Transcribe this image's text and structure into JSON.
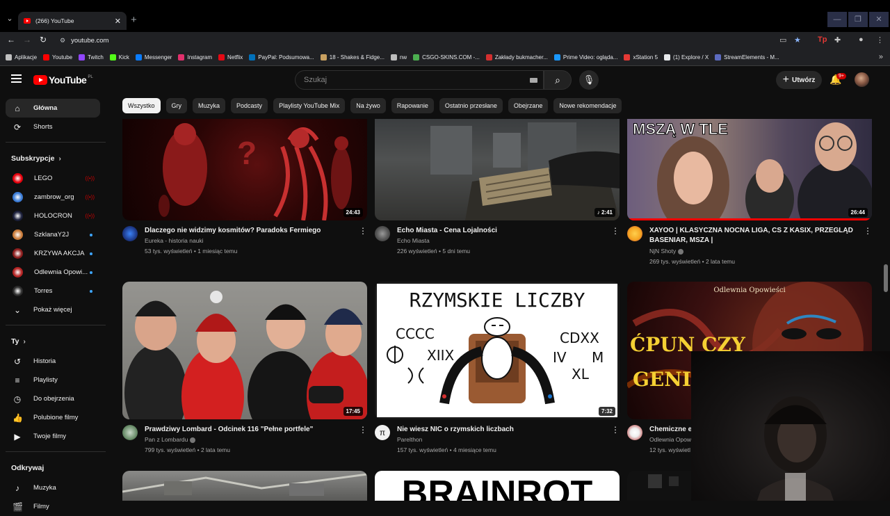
{
  "browser": {
    "tab_title": "(266) YouTube",
    "url": "youtube.com",
    "bookmarks": [
      {
        "label": "Aplikacje",
        "color": "#c0c0c0"
      },
      {
        "label": "Youtube",
        "color": "#ff0000"
      },
      {
        "label": "Twitch",
        "color": "#9146ff"
      },
      {
        "label": "Kick",
        "color": "#53fc18"
      },
      {
        "label": "Messenger",
        "color": "#0a7cff"
      },
      {
        "label": "Instagram",
        "color": "#e1306c"
      },
      {
        "label": "Netflix",
        "color": "#e50914"
      },
      {
        "label": "PayPal: Podsumowa...",
        "color": "#0070ba"
      },
      {
        "label": "18 - Shakes & Fidge...",
        "color": "#c8a060"
      },
      {
        "label": "nw",
        "color": "#bdbdbd"
      },
      {
        "label": "CSGO-SKINS.COM -...",
        "color": "#4caf50"
      },
      {
        "label": "Zakłady bukmacher...",
        "color": "#d32f2f"
      },
      {
        "label": "Prime Video: ogląda...",
        "color": "#1a98ff"
      },
      {
        "label": "xStation 5",
        "color": "#e53935"
      },
      {
        "label": "(1) Explore / X",
        "color": "#e8eaed"
      },
      {
        "label": "StreamElements - M...",
        "color": "#5c6bc0"
      }
    ]
  },
  "header": {
    "logo_text": "YouTube",
    "region": "PL",
    "search_placeholder": "Szukaj",
    "create_label": "Utwórz",
    "notif_count": "9+"
  },
  "chips": [
    "Wszystko",
    "Gry",
    "Muzyka",
    "Podcasty",
    "Playlisty YouTube Mix",
    "Na żywo",
    "Rapowanie",
    "Ostatnio przesłane",
    "Obejrzane",
    "Nowe rekomendacje"
  ],
  "sidebar": {
    "main": [
      {
        "label": "Główna",
        "icon": "home-icon"
      },
      {
        "label": "Shorts",
        "icon": "shorts-icon"
      }
    ],
    "subs_heading": "Subskrypcje",
    "subs": [
      {
        "label": "LEGO",
        "color": "#e3000b",
        "status": "live"
      },
      {
        "label": "zambrow_org",
        "color": "#3a7bd5",
        "status": "live"
      },
      {
        "label": "HOLOCRON",
        "color": "#1b1f3a",
        "status": "live"
      },
      {
        "label": "SzklanaY2J",
        "color": "#c97b3a",
        "status": "dot"
      },
      {
        "label": "KRZYWA AKCJA",
        "color": "#8a1c1c",
        "status": "dot"
      },
      {
        "label": "Odlewnia Opowi...",
        "color": "#b22222",
        "status": "dot"
      },
      {
        "label": "Torres",
        "color": "#2b2b2b",
        "status": "dot"
      }
    ],
    "show_more": "Pokaż więcej",
    "you_heading": "Ty",
    "you": [
      {
        "label": "Historia",
        "icon": "history-icon"
      },
      {
        "label": "Playlisty",
        "icon": "playlist-icon"
      },
      {
        "label": "Do obejrzenia",
        "icon": "watch-later-icon"
      },
      {
        "label": "Polubione filmy",
        "icon": "like-icon"
      },
      {
        "label": "Twoje filmy",
        "icon": "your-videos-icon"
      }
    ],
    "explore_heading": "Odkrywaj",
    "explore": [
      {
        "label": "Muzyka",
        "icon": "music-icon"
      },
      {
        "label": "Filmy",
        "icon": "film-icon"
      }
    ]
  },
  "videos": [
    {
      "title": "Dlaczego nie widzimy kosmitów? Paradoks Fermiego",
      "channel": "Eureka - historia nauki",
      "views": "53 tys. wyświetleń",
      "age": "1 miesiąc temu",
      "duration": "24:43",
      "verified": false,
      "avatar_color": "#1e3a8a"
    },
    {
      "title": "Echo Miasta - Cena Lojalności",
      "channel": "Echo Miasta",
      "views": "226 wyświetleń",
      "age": "5 dni temu",
      "duration": "2:41",
      "verified": false,
      "avatar_color": "#555555"
    },
    {
      "title": "XAYOO | KLASYCZNA NOCNA LIGA, CS Z KASIX, PRZEGLĄD BASENIAR, MSZA |",
      "channel": "NjN Shoty",
      "views": "269 tys. wyświetleń",
      "age": "2 lata temu",
      "duration": "26:44",
      "verified": true,
      "avatar_color": "#f5a623",
      "progress": 1.0
    },
    {
      "title": "Prawdziwy Lombard - Odcinek 116 \"Pełne portfele\"",
      "channel": "Pan z Lombardu",
      "views": "799 tys. wyświetleń",
      "age": "2 lata temu",
      "duration": "17:45",
      "verified": true,
      "avatar_color": "#6b8e6b"
    },
    {
      "title": "Nie wiesz NIC o rzymskich liczbach",
      "channel": "Parelthon",
      "views": "157 tys. wyświetleń",
      "age": "4 miesiące temu",
      "duration": "7:32",
      "verified": false,
      "avatar_color": "#f1f1f1"
    },
    {
      "title": "Chemiczne e",
      "channel": "Odlewnia Opow",
      "views": "12 tys. wyświetl",
      "age": "",
      "duration": "",
      "verified": false,
      "avatar_color": "#b22222"
    }
  ],
  "thumb_text": {
    "v3": "MSZĄ W TLE",
    "v5_title": "RZYMSKIE LICZBY",
    "v5_numerals": [
      "CCCC",
      "XIIX",
      "CDXX",
      "IV",
      "M",
      "XL"
    ],
    "v6_brand": "Odlewnia Opowieści",
    "v6_line1": "ĆPUN CZY",
    "v6_line2": "GENI",
    "v8": "BRAINROT"
  }
}
